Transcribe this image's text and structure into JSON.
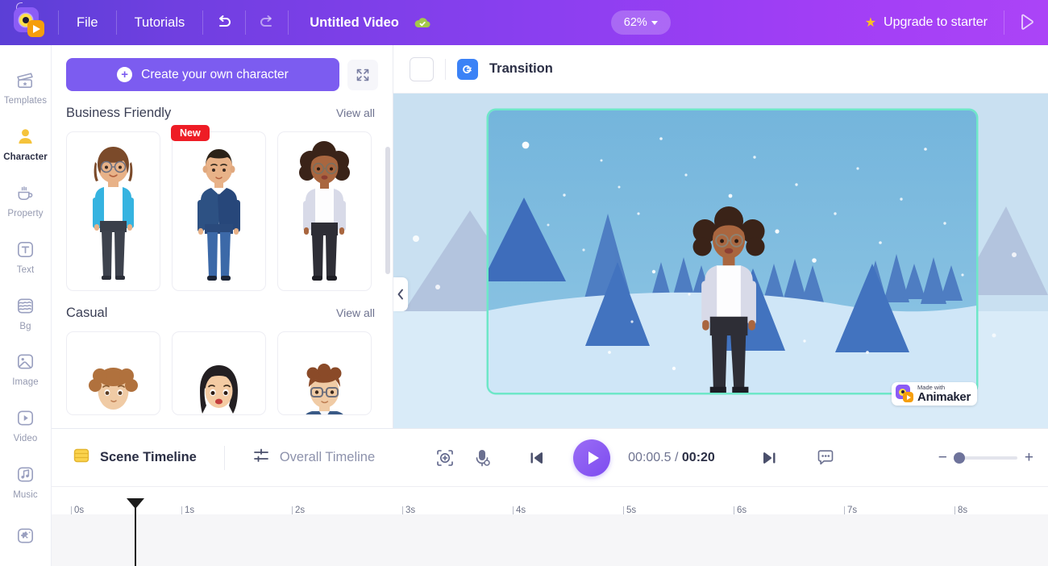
{
  "topbar": {
    "logo_name": "animaker-logo",
    "menu": [
      {
        "label": "File",
        "name": "menu-file"
      },
      {
        "label": "Tutorials",
        "name": "menu-tutorials"
      }
    ],
    "undo_icon": "undo-icon",
    "redo_icon": "redo-icon",
    "project_title": "Untitled Video",
    "cloud_icon": "cloud-saved-icon",
    "zoom_level": "62%",
    "upgrade_label": "Upgrade to starter",
    "star_icon": "star-icon",
    "publish_icon": "publish-play-icon",
    "accent": "#8b3ff0"
  },
  "sidebar": {
    "items": [
      {
        "label": "Templates",
        "icon": "templates-icon",
        "active": false
      },
      {
        "label": "Character",
        "icon": "character-icon",
        "active": true
      },
      {
        "label": "Property",
        "icon": "property-cup-icon",
        "active": false
      },
      {
        "label": "Text",
        "icon": "text-icon",
        "active": false
      },
      {
        "label": "Bg",
        "icon": "background-icon",
        "active": false
      },
      {
        "label": "Image",
        "icon": "image-icon",
        "active": false
      },
      {
        "label": "Video",
        "icon": "video-icon",
        "active": false
      },
      {
        "label": "Music",
        "icon": "music-icon",
        "active": false
      },
      {
        "label": "",
        "icon": "effects-puzzle-icon",
        "active": false
      }
    ]
  },
  "panel": {
    "create_button": "Create your own character",
    "expand_icon": "expand-arrows-icon",
    "sections": [
      {
        "title": "Business Friendly",
        "view_all": "View all",
        "cards": [
          {
            "name": "character-card-1",
            "badge": null,
            "alt": "woman-glasses-blue-cardigan"
          },
          {
            "name": "character-card-2",
            "badge": "New",
            "alt": "man-navy-suit"
          },
          {
            "name": "character-card-3",
            "badge": null,
            "alt": "woman-afro-grey-cardigan"
          }
        ]
      },
      {
        "title": "Casual",
        "view_all": "View all",
        "cards": [
          {
            "name": "character-card-4",
            "badge": null,
            "alt": "curly-hair-person"
          },
          {
            "name": "character-card-5",
            "badge": null,
            "alt": "long-black-hair-woman"
          },
          {
            "name": "character-card-6",
            "badge": null,
            "alt": "man-glasses-blue-shirt"
          }
        ]
      }
    ]
  },
  "stage": {
    "transition_checkbox": "transition-checkbox",
    "transition_icon": "transition-icon",
    "transition_label": "Transition",
    "collapse_icon": "chevron-left-icon",
    "watermark": {
      "made_with": "Made with",
      "brand": "Animaker"
    },
    "scene_alt": "winter-snow-scene-with-character",
    "frame_border_color": "#6ee7c8"
  },
  "timeline": {
    "scene_tab": "Scene Timeline",
    "scene_tab_icon": "scene-timeline-icon",
    "overall_tab": "Overall Timeline",
    "overall_tab_icon": "overall-timeline-icon",
    "add_scene_icon": "add-scene-icon",
    "mic_icon": "microphone-icon",
    "prev_icon": "previous-scene-icon",
    "next_icon": "next-scene-icon",
    "caption_icon": "subtitle-icon",
    "current_time": "00:00.5",
    "time_separator": "/",
    "total_time": "00:20",
    "zoom_minus": "−",
    "zoom_plus": "+",
    "ruler_ticks": [
      "0s",
      "1s",
      "2s",
      "3s",
      "4s",
      "5s",
      "6s",
      "7s",
      "8s"
    ],
    "playhead_name": "timeline-playhead"
  }
}
